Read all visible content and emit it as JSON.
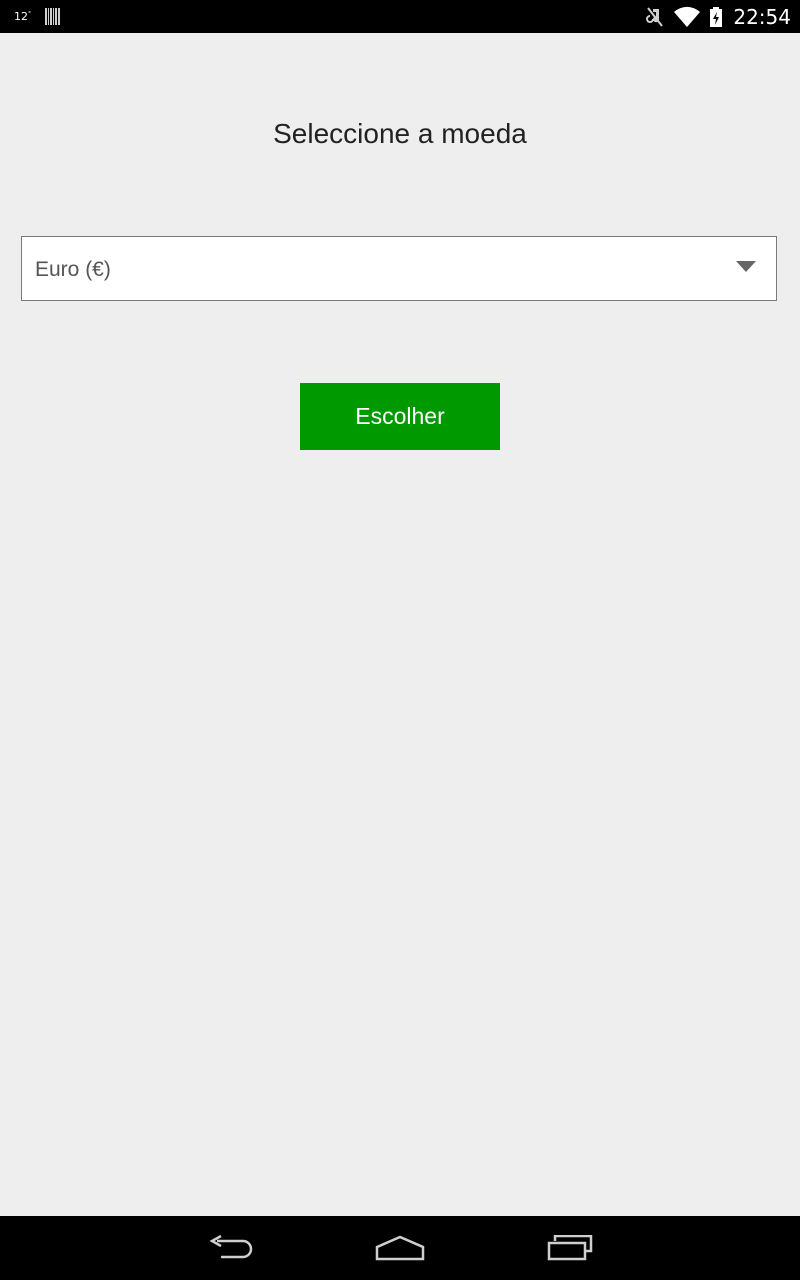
{
  "status_bar": {
    "temperature": "12",
    "temperature_unit": "°",
    "time": "22:54",
    "icons": [
      "barcode-icon",
      "mute-icon",
      "wifi-icon",
      "battery-charging-icon"
    ]
  },
  "main": {
    "title": "Seleccione a moeda",
    "currency_select": {
      "selected": "Euro (€)"
    },
    "choose_button": {
      "label": "Escolher"
    }
  },
  "nav_bar": {
    "icons": [
      "back-icon",
      "home-icon",
      "recent-apps-icon"
    ]
  },
  "colors": {
    "accent": "#009900",
    "background": "#eeeeee",
    "bars": "#000000"
  }
}
